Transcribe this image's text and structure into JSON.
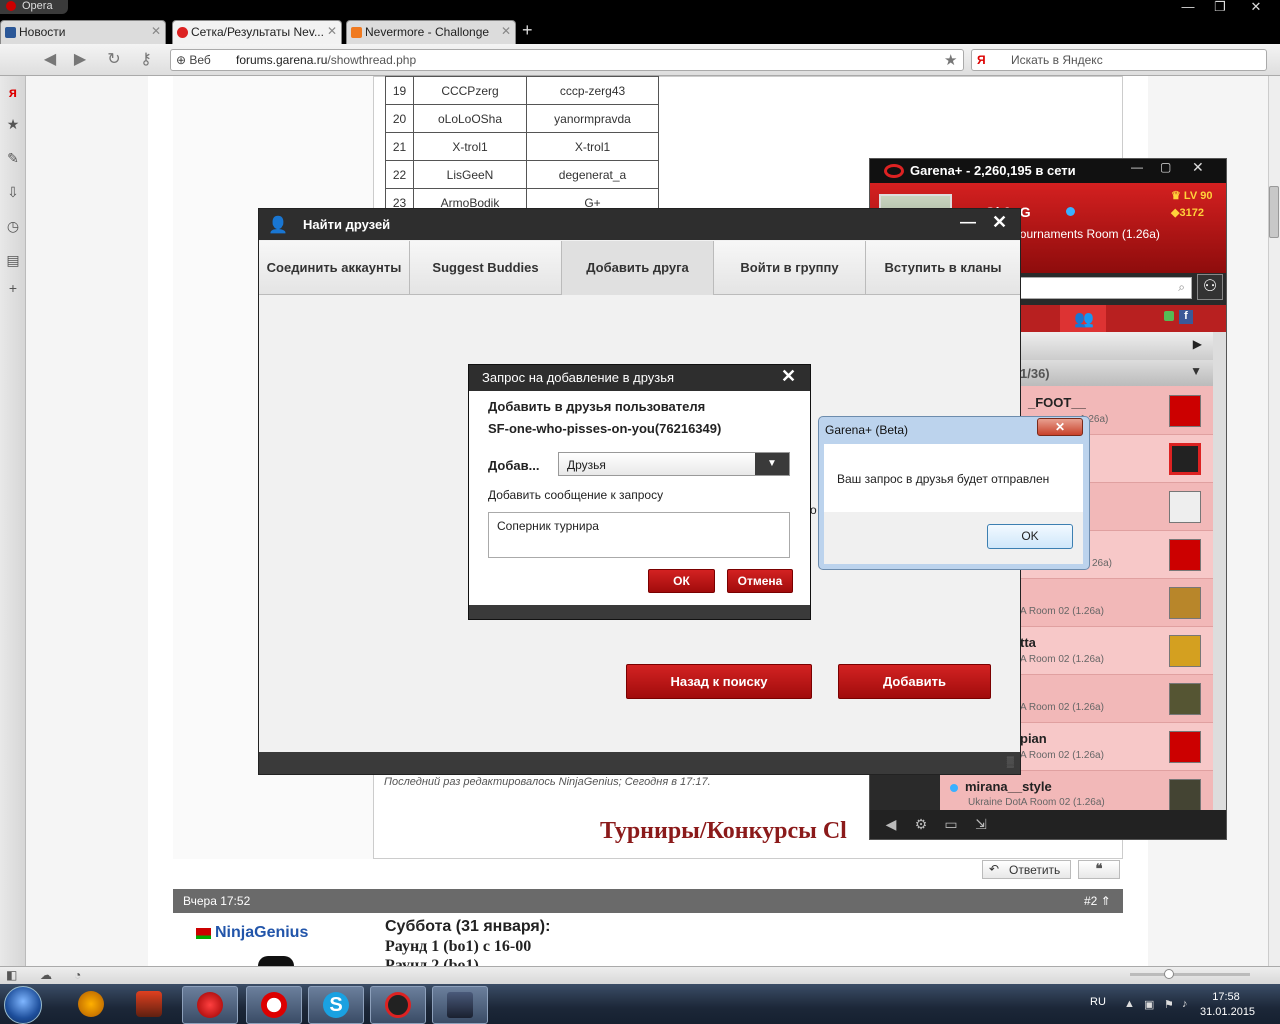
{
  "browser": {
    "opera_label": "Opera",
    "tabs": [
      {
        "label": "Новости",
        "fav_color": "#2b5797"
      },
      {
        "label": "Сетка/Результаты Nev...",
        "fav_color": "#d22"
      },
      {
        "label": "Nevermore - Challonge",
        "fav_color": "#f07a20"
      }
    ],
    "new_tab": "+",
    "web_label": "Веб",
    "url_host": "forums.garena.ru",
    "url_path": "/showthread.php",
    "search_logo": "Я",
    "search_placeholder": "Искать в Яндекс"
  },
  "page": {
    "table_rows": [
      {
        "n": "19",
        "nick": "CCCPzerg",
        "login": "cccp-zerg43"
      },
      {
        "n": "20",
        "nick": "oLoLoOSha",
        "login": "yanormpravda"
      },
      {
        "n": "21",
        "nick": "X-trol1",
        "login": "X-trol1"
      },
      {
        "n": "22",
        "nick": "LisGeeN",
        "login": "degenerat_a"
      },
      {
        "n": "23",
        "nick": "ArmoBodik",
        "login": "G+"
      }
    ],
    "edited_note": "Последний раз редактировалось NinjaGenius; Сегодня в 17:17.",
    "tournaments_heading": "Турниры/Конкурсы Cl",
    "reply_label": "Ответить",
    "quote_label": "❝",
    "post2": {
      "date": "Вчера 17:52",
      "number": "#2",
      "author": "NinjaGenius",
      "line1": "Суббота (31 января):",
      "line2": "Раунд 1 (bo1) с 16-00",
      "line3": "Раунд 2 (bo1)"
    }
  },
  "garena": {
    "title": "Garena+ - 2,260,195 в сети",
    "username": "-=.Gi.0nG",
    "room": "tA Tournaments Room (1.26a)",
    "level": "LV 90",
    "points": "3172",
    "count_label": "1/36)",
    "friends": [
      {
        "name": "_FOOT__",
        "sub": "1.26a)",
        "avatar_color": "#c00"
      },
      {
        "name": "",
        "sub": "",
        "avatar_color": "#c00"
      },
      {
        "name": "",
        "sub": "",
        "avatar_color": "#eee"
      },
      {
        "name": "",
        "sub": "26a)",
        "avatar_color": "#c00"
      },
      {
        "name": "",
        "sub": "A Room 02 (1.26a)",
        "avatar_color": "#b8862a"
      },
      {
        "name": "tta",
        "sub": "A Room 02 (1.26a)",
        "avatar_color": "#d4a020"
      },
      {
        "name": "",
        "sub": "A Room 02 (1.26a)",
        "avatar_color": "#553"
      },
      {
        "name": "pian",
        "sub": "A Room 02 (1.26a)",
        "avatar_color": "#c00"
      },
      {
        "name": "mirana__style",
        "sub": "Ukraine DotA Room 02 (1.26a)",
        "avatar_color": "#443"
      }
    ]
  },
  "find_friends": {
    "title": "Найти друзей",
    "tabs": [
      "Соединить аккаунты",
      "Suggest Buddies",
      "Добавить друга",
      "Войти в группу",
      "Вступить в кланы"
    ],
    "selected_tab": 2,
    "back_label": "Назад к поиску",
    "add_label": "Добавить"
  },
  "request": {
    "title": "Запрос на добавление в друзья",
    "line1": "Добавить в друзья пользователя",
    "line2": "SF-one-who-pisses-on-you(76216349)",
    "group_label": "Добав...",
    "group_value": "Друзья",
    "message_label": "Добавить сообщение к запросу",
    "message_value": "Соперник турнира",
    "ok_label": "ОК",
    "cancel_label": "Отмена",
    "overflow_char": "о"
  },
  "msgbox": {
    "title": "Garena+ (Beta)",
    "text": "Ваш запрос в друзья будет отправлен",
    "ok_label": "OK"
  },
  "taskbar": {
    "lang": "RU",
    "time": "17:58",
    "date": "31.01.2015"
  }
}
